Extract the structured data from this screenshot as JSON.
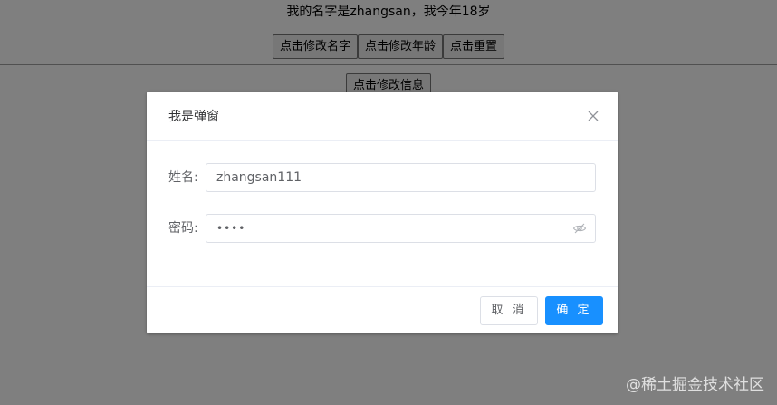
{
  "page": {
    "info_text": "我的名字是zhangsan，我今年18岁",
    "buttons_row1": [
      "点击修改名字",
      "点击修改年龄",
      "点击重置"
    ],
    "button_row2": "点击修改信息"
  },
  "dialog": {
    "title": "我是弹窗",
    "close_icon": "close-icon",
    "name_label": "姓名:",
    "name_value": "zhangsan111",
    "password_label": "密码:",
    "password_value": "••••",
    "eye_icon": "eye-hidden-icon",
    "cancel_label": "取 消",
    "confirm_label": "确 定",
    "confirm_color": "#1890ff"
  },
  "watermark": "@稀土掘金技术社区"
}
